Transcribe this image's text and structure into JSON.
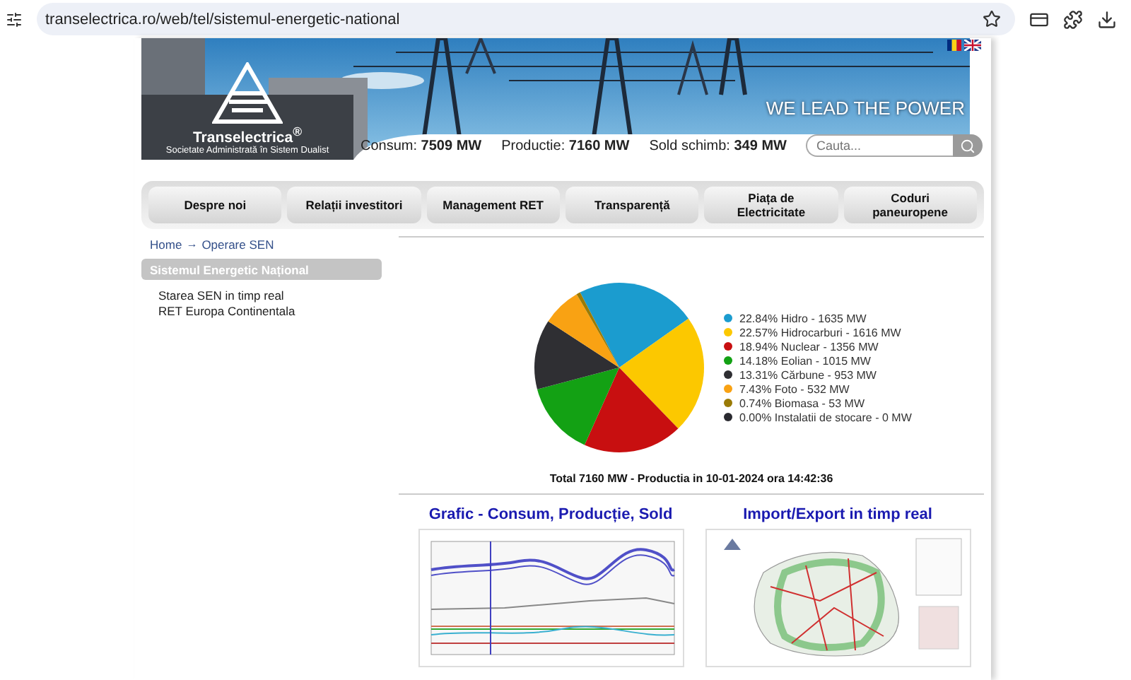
{
  "browser": {
    "url": "transelectrica.ro/web/tel/sistemul-energetic-national"
  },
  "header": {
    "brand": "Transelectrica$^{®}$",
    "brand_subtitle": "Societate Administrată în Sistem Dualist",
    "slogan": "WE LEAD THE POWER",
    "stats": [
      {
        "label": "Consum:",
        "value": "7509 MW"
      },
      {
        "label": "Productie:",
        "value": "7160 MW"
      },
      {
        "label": "Sold schimb:",
        "value": "349 MW"
      }
    ],
    "search": {
      "placeholder": "Cauta..."
    }
  },
  "nav": [
    {
      "label": "Despre noi"
    },
    {
      "label": "Relații investitori"
    },
    {
      "label": "Management RET"
    },
    {
      "label": "Transparență"
    },
    {
      "label": "Piața de Electricitate"
    },
    {
      "label": "Coduri paneuropene"
    }
  ],
  "breadcrumb": {
    "items": [
      "Home",
      "Operare SEN"
    ],
    "separator": "→"
  },
  "sidebar": {
    "title": "Sistemul Energetic Național",
    "items": [
      "Starea SEN in timp real",
      "RET Europa Continentala"
    ]
  },
  "production": {
    "chart_data": {
      "type": "pie",
      "categories": [
        "Hidro",
        "Hidrocarburi",
        "Nuclear",
        "Eolian",
        "Cărbune",
        "Foto",
        "Biomasa",
        "Instalatii de stocare"
      ],
      "values": [
        22.84,
        22.57,
        18.94,
        14.18,
        13.31,
        7.43,
        0.74,
        0.0
      ],
      "colors": [
        "#1b9ccf",
        "#fcc800",
        "#c80f10",
        "#13a114",
        "#2f2f33",
        "#f9a213",
        "#9a7b06",
        "#2a2a30"
      ]
    },
    "legend": [
      {
        "percent": "22.84%",
        "reading": "- 1635 MW"
      },
      {
        "percent": "22.57%",
        "reading": "- 1616 MW"
      },
      {
        "percent": "18.94%",
        "reading": "- 1356 MW"
      },
      {
        "percent": "14.18%",
        "reading": "- 1015 MW"
      },
      {
        "percent": "13.31%",
        "reading": "- 953 MW"
      },
      {
        "percent": "7.43%",
        "reading": "- 532 MW"
      },
      {
        "percent": "0.74%",
        "reading": "- 53 MW"
      },
      {
        "percent": "0.00%",
        "reading": "- 0 MW"
      }
    ],
    "total": "Total 7160 MW - Productia in 10-01-2024 ora 14:42:36"
  },
  "links": [
    {
      "title": "Grafic - Consum, Producție, Sold",
      "kind": "graph"
    },
    {
      "title": "Import/Export in timp real",
      "kind": "map"
    }
  ]
}
